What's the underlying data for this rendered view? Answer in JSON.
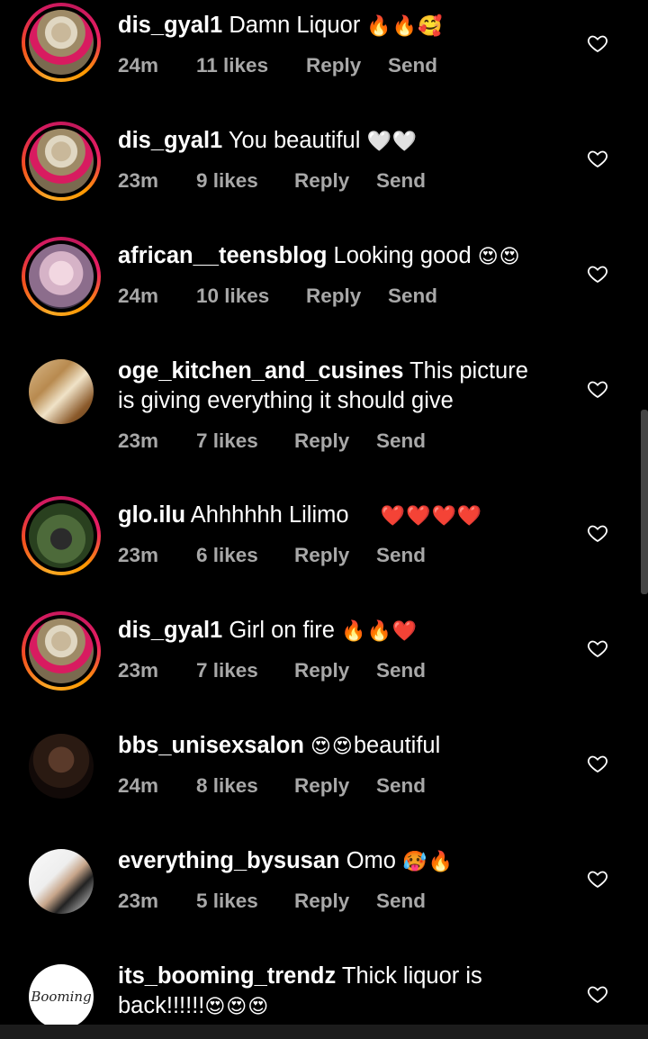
{
  "comments": [
    {
      "user": "dis_gyal1",
      "text": "Damn Liquor",
      "emoji": "🔥🔥🥰",
      "time": "24m",
      "likes": "11 likes",
      "reply": "Reply",
      "send": "Send"
    },
    {
      "user": "dis_gyal1",
      "text": "You beautiful",
      "emoji": "🤍🤍",
      "time": "23m",
      "likes": "9 likes",
      "reply": "Reply",
      "send": "Send"
    },
    {
      "user": "african__teensblog",
      "text": "Looking good",
      "emoji": "😍😍",
      "time": "24m",
      "likes": "10 likes",
      "reply": "Reply",
      "send": "Send"
    },
    {
      "user": "oge_kitchen_and_cusines",
      "text": "This picture is giving everything it should give",
      "emoji": "",
      "time": "23m",
      "likes": "7 likes",
      "reply": "Reply",
      "send": "Send"
    },
    {
      "user": "glo.ilu",
      "text": "Ahhhhhh Lilimo",
      "emoji": "❤️❤️❤️❤️",
      "time": "23m",
      "likes": "6 likes",
      "reply": "Reply",
      "send": "Send"
    },
    {
      "user": "dis_gyal1",
      "text": "Girl on fire",
      "emoji": "🔥🔥❤️",
      "time": "23m",
      "likes": "7 likes",
      "reply": "Reply",
      "send": "Send"
    },
    {
      "user": "bbs_unisexsalon",
      "text": "beautiful",
      "emoji": "😍😍",
      "time": "24m",
      "likes": "8 likes",
      "reply": "Reply",
      "send": "Send"
    },
    {
      "user": "everything_bysusan",
      "text": "Omo",
      "emoji": "🥵🔥",
      "time": "23m",
      "likes": "5 likes",
      "reply": "Reply",
      "send": "Send"
    },
    {
      "user": "its_booming_trendz",
      "text": "Thick liquor is back!!!!!!",
      "emoji": "😍😍😍",
      "time": "",
      "likes": "",
      "reply": "",
      "send": ""
    }
  ],
  "booming_logo": "Booming",
  "colors": {
    "meta": "#a8a8a8",
    "story_ring": "#d81b60"
  }
}
